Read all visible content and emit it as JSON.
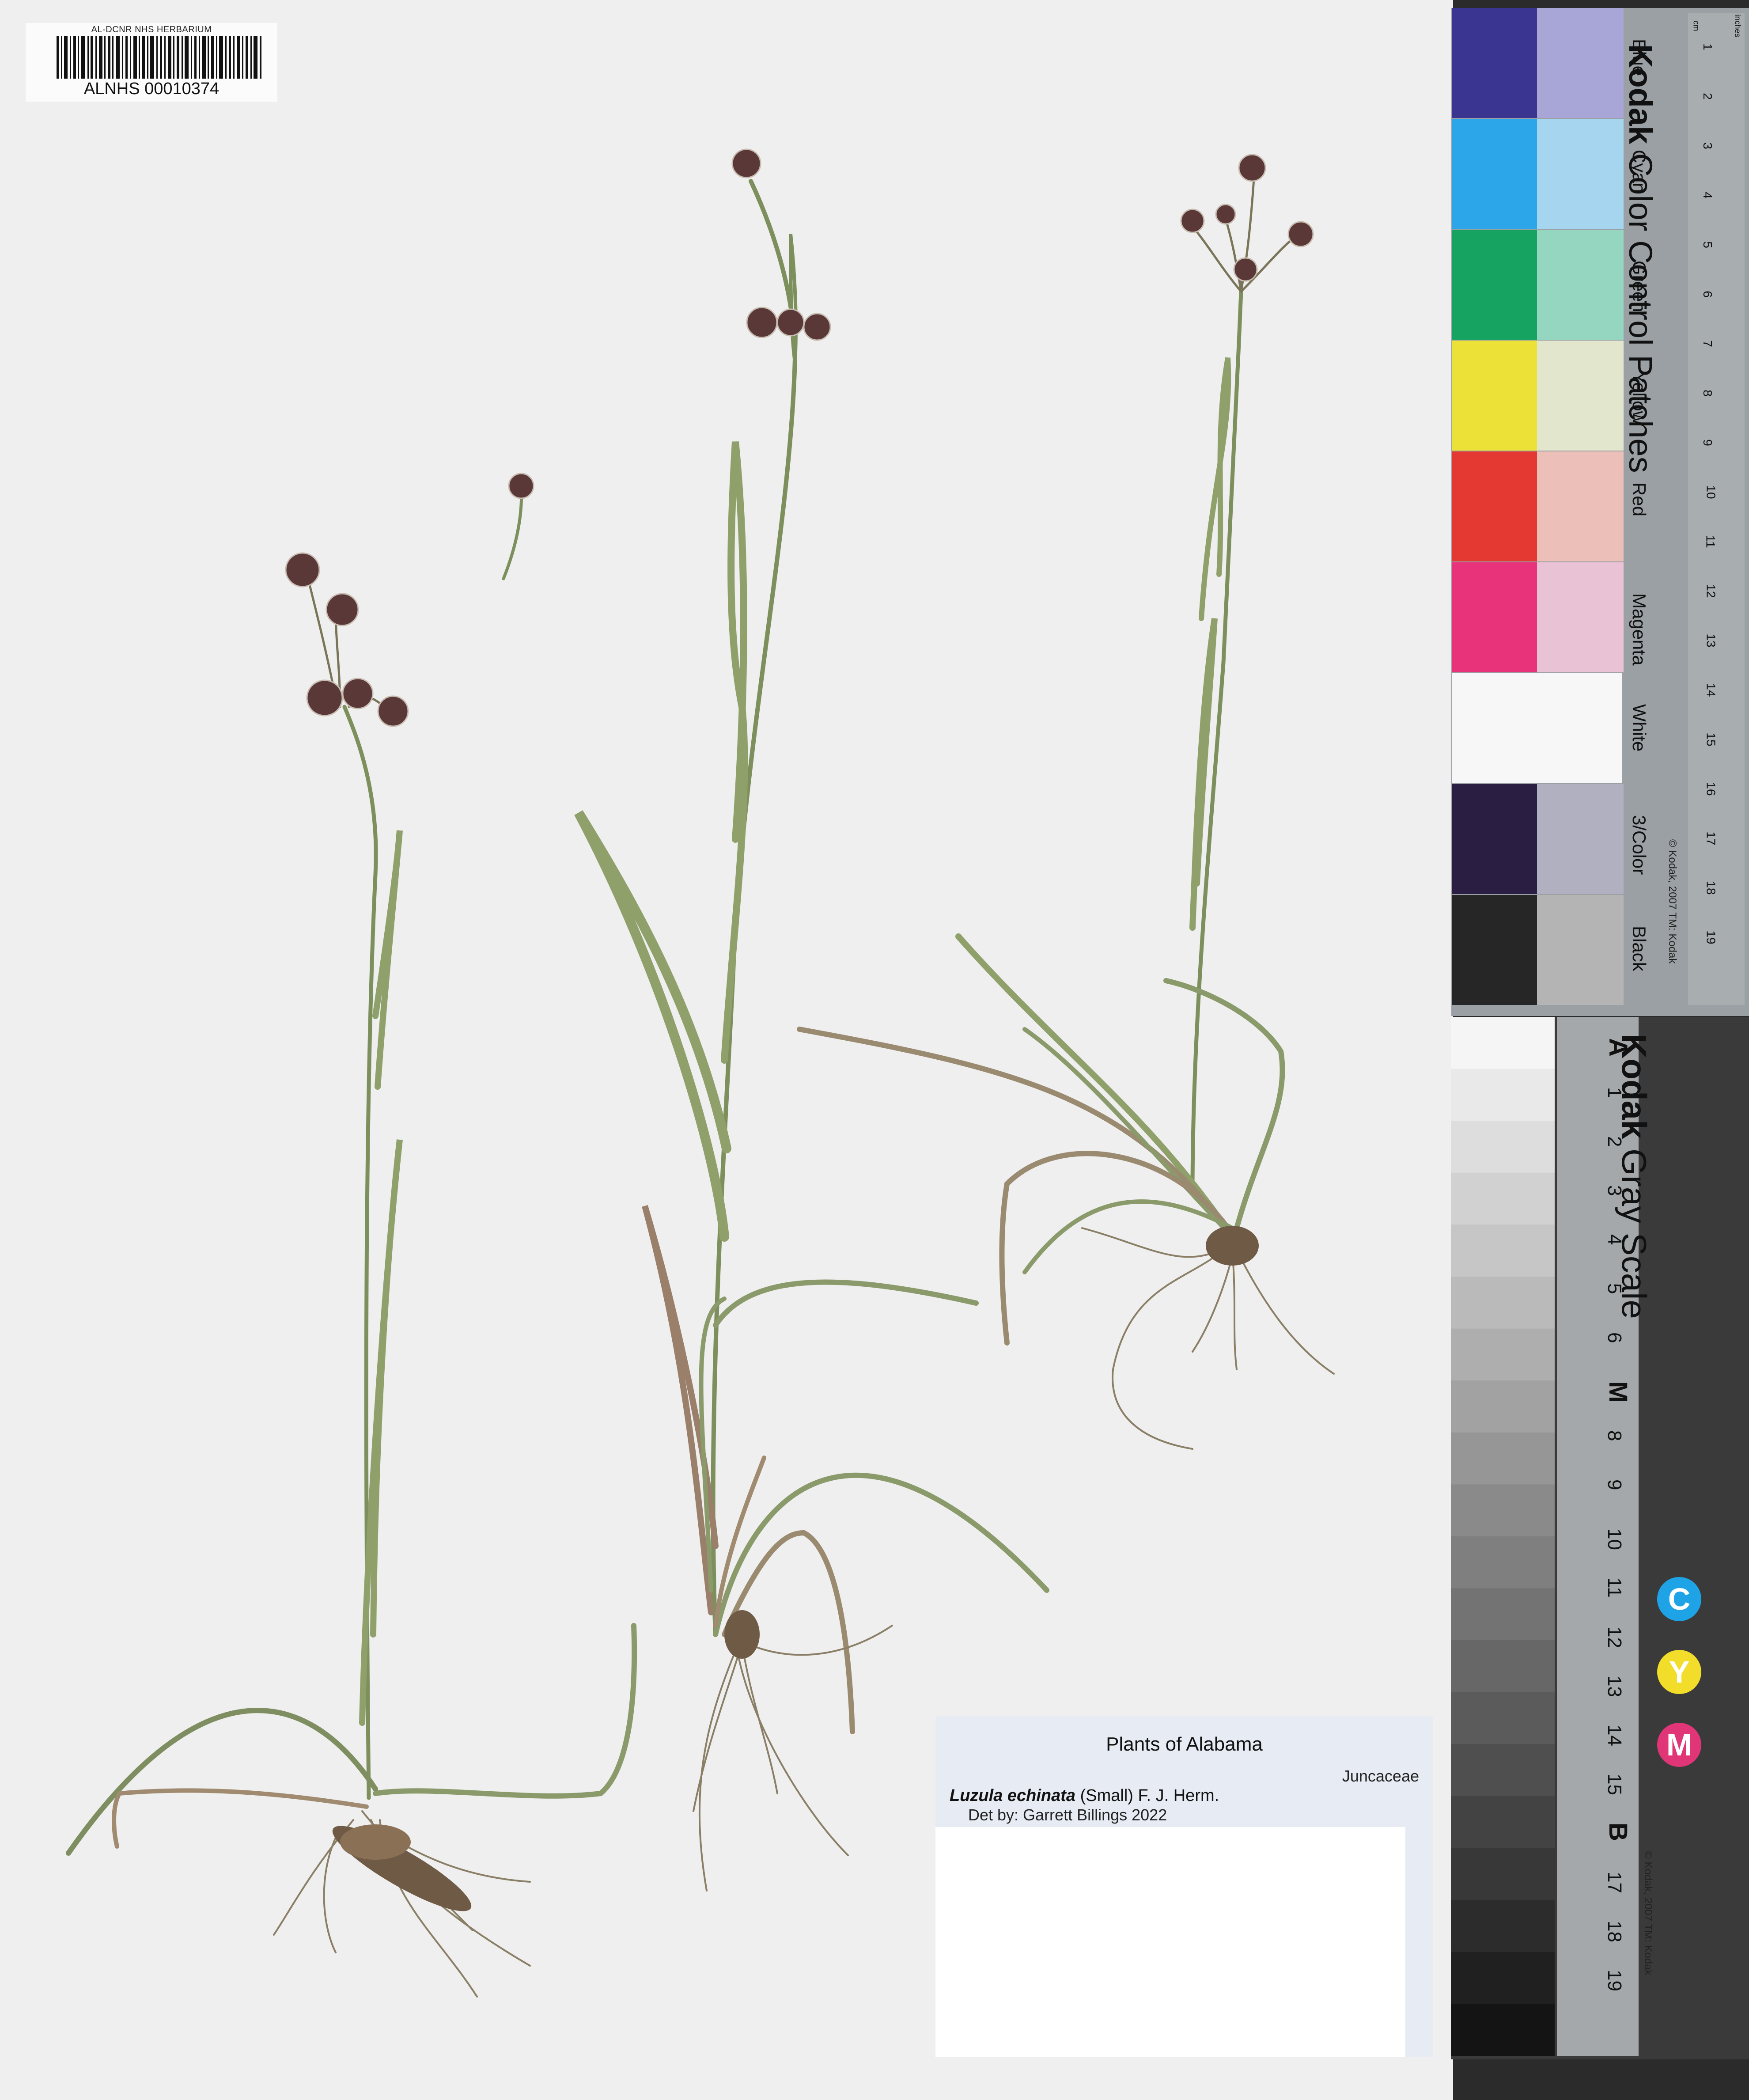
{
  "barcode": {
    "institution": "AL-DCNR NHS HERBARIUM",
    "catalog_number": "ALNHS 00010374"
  },
  "color_card": {
    "brand": "Kodak",
    "title": "Color Control Patches",
    "copyright": "© Kodak, 2007 TM: Kodak",
    "patches": [
      {
        "label": "Blue",
        "dark": "#3b3592",
        "light": "#a8a6d6"
      },
      {
        "label": "Cyan",
        "dark": "#2ca6e8",
        "light": "#a6d6ef"
      },
      {
        "label": "Green",
        "dark": "#16a261",
        "light": "#95d6c0"
      },
      {
        "label": "Yellow",
        "dark": "#ece237",
        "light": "#e2e6cc"
      },
      {
        "label": "Red",
        "dark": "#e43833",
        "light": "#ecc0b8"
      },
      {
        "label": "Magenta",
        "dark": "#e8327a",
        "light": "#eac2d6"
      },
      {
        "label": "White",
        "dark": "#f7f7f7",
        "light": "#f7f7f7"
      },
      {
        "label": "3/Color",
        "dark": "#2a1e42",
        "light": "#b1b0c1"
      },
      {
        "label": "Black",
        "dark": "#262626",
        "light": "#b4b4b4"
      }
    ],
    "ruler_cm": [
      "cm",
      "1",
      "2",
      "3",
      "4",
      "5",
      "6",
      "7",
      "8",
      "9",
      "10",
      "11",
      "12",
      "13",
      "14",
      "15",
      "16",
      "17",
      "18",
      "19"
    ],
    "ruler_inch_label": "inches"
  },
  "gray_scale": {
    "brand": "Kodak",
    "title": "Gray Scale",
    "copyright": "© Kodak, 2007 TM: Kodak",
    "steps": [
      "A",
      "1",
      "2",
      "3",
      "4",
      "5",
      "6",
      "M",
      "8",
      "9",
      "10",
      "11",
      "12",
      "13",
      "14",
      "15",
      "B",
      "17",
      "18",
      "19"
    ],
    "cym": [
      {
        "letter": "C",
        "color": "#1ea4e6"
      },
      {
        "letter": "Y",
        "color": "#f1dd2a"
      },
      {
        "letter": "M",
        "color": "#e03576"
      }
    ]
  },
  "label": {
    "title": "Plants of Alabama",
    "family": "Juncaceae",
    "scientific_name": "Luzula echinata",
    "authority": "(Small) F. J. Herm.",
    "determined_by": "Det by: Garrett Billings 2022"
  }
}
